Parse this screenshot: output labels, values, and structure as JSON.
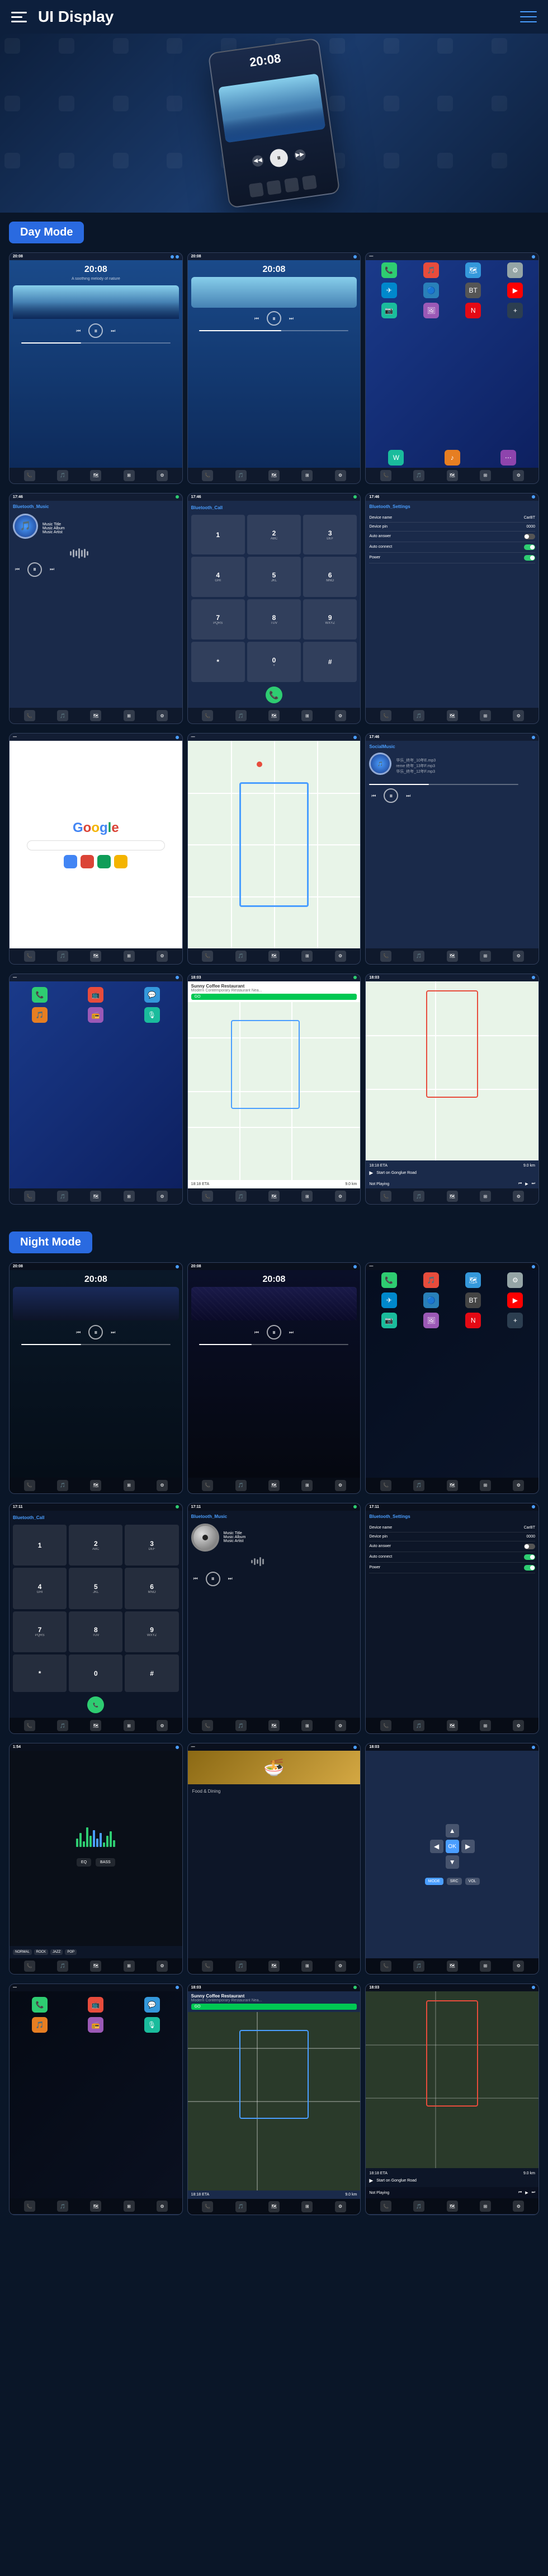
{
  "header": {
    "title": "UI Display",
    "menu_aria": "menu",
    "nav_aria": "navigation"
  },
  "modes": {
    "day": "Day Mode",
    "night": "Night Mode"
  },
  "screens": {
    "music_time": "20:08",
    "music_subtitle": "A soothing melody of nature",
    "music_title": "Music Title",
    "music_album": "Music Album",
    "music_artist": "Music Artist",
    "bluetooth_music": "Bluetooth_Music",
    "bluetooth_call": "Bluetooth_Call",
    "bluetooth_settings": "Bluetooth_Settings",
    "device_name_label": "Device name",
    "device_name_value": "CarBT",
    "device_pin_label": "Device pin",
    "device_pin_value": "0000",
    "auto_answer_label": "Auto answer",
    "auto_connect_label": "Auto connect",
    "power_label": "Power",
    "google_text": "Google",
    "social_music_title": "SocialMusic",
    "nav_coffee": "Sunny Coffee Restaurant",
    "nav_address": "Modern Contemporary Restaurant Nea...",
    "nav_go": "GO",
    "nav_eta": "18:18 ETA",
    "nav_distance": "9.0 km",
    "nav_playing": "Not Playing",
    "nav_road": "Start on Gonglue Road",
    "night_music_time1": "20:08",
    "night_music_time2": "20:08",
    "food_emoji": "🍜"
  },
  "day_mode_rows": [
    {
      "id": "row1",
      "screens": [
        "music-player-day-1",
        "music-player-day-2",
        "app-grid-day"
      ]
    },
    {
      "id": "row2",
      "screens": [
        "bluetooth-music-day",
        "bluetooth-call-day",
        "bluetooth-settings-day"
      ]
    },
    {
      "id": "row3",
      "screens": [
        "google-day",
        "map-day",
        "social-music-day"
      ]
    },
    {
      "id": "row4",
      "screens": [
        "phone-apps-day",
        "navigation-day",
        "navigation-music-day"
      ]
    }
  ],
  "night_mode_rows": [
    {
      "id": "nrow1",
      "screens": [
        "music-player-night-1",
        "music-player-night-2",
        "app-grid-night"
      ]
    },
    {
      "id": "nrow2",
      "screens": [
        "bluetooth-call-night",
        "bluetooth-music-night",
        "bluetooth-settings-night"
      ]
    },
    {
      "id": "nrow3",
      "screens": [
        "waveform-night",
        "food-night",
        "map-arrows-night"
      ]
    },
    {
      "id": "nrow4",
      "screens": [
        "phone-apps-night",
        "navigation-night",
        "navigation-end-night"
      ]
    }
  ]
}
